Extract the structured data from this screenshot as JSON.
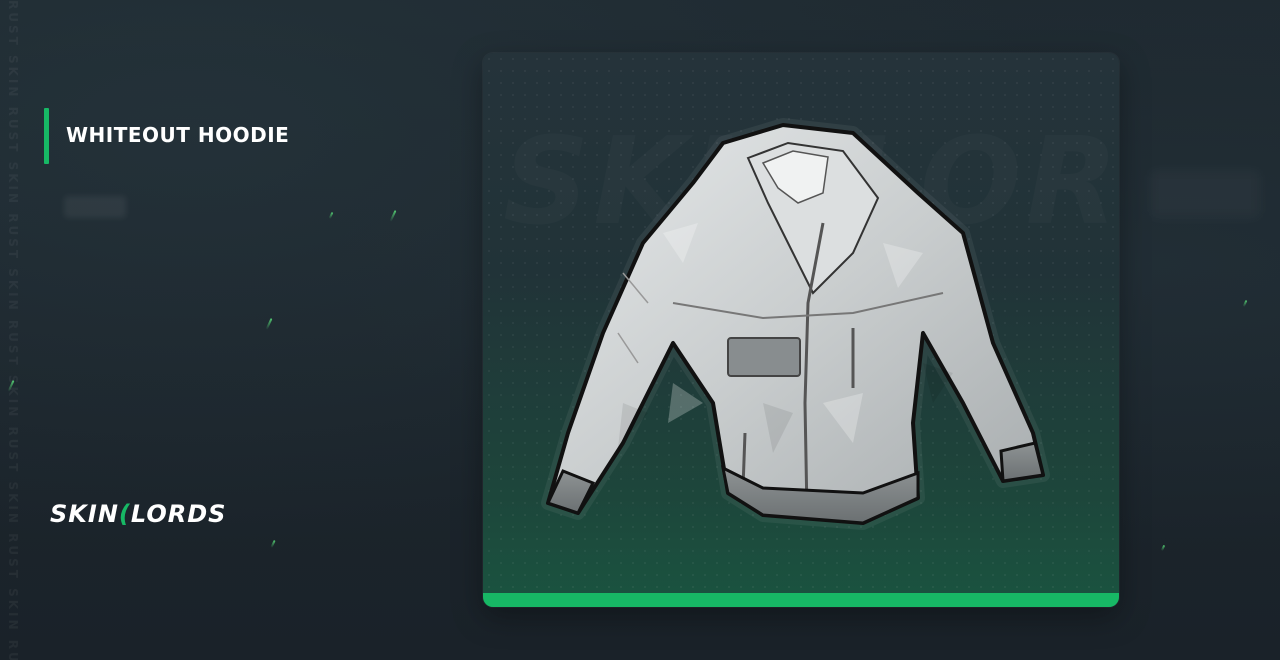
{
  "item": {
    "name": "WHITEOUT HOODIE"
  },
  "brand": {
    "logo_left": "SKIN",
    "logo_mark": "(",
    "logo_right": "LORDS",
    "watermark_side": "RUST SKIN RUST SKIN RUST SKIN RUST SKIN RUST SKIN RUST SKIN RUST SKIN",
    "watermark_card": "SKINLORDS"
  },
  "colors": {
    "accent": "#17b865",
    "background": "#1b242b",
    "card_top": "#25333a",
    "card_bottom": "#1a5440"
  },
  "icons": {
    "item_image": "hoodie-icon"
  }
}
